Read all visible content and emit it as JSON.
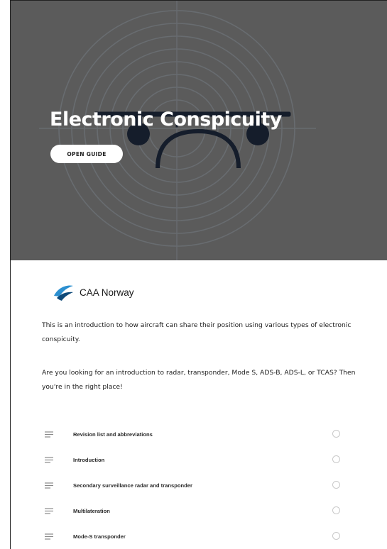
{
  "hero": {
    "title": "Electronic Conspicuity",
    "button_label": "OPEN GUIDE",
    "background_color": "#5b5b5b",
    "icon": "drone-radar-illustration"
  },
  "brand": {
    "name": "CAA Norway",
    "logo_icon": "caa-norway-logo",
    "logo_colors": [
      "#2b8fd0",
      "#0f4a7a"
    ]
  },
  "description": {
    "paragraph_1": "This is an introduction to how aircraft can share their position using various types of electronic conspicuity.",
    "paragraph_2": "Are you looking for an introduction to radar, transponder, Mode S, ADS-B, ADS-L, or TCAS? Then you're in the right place!"
  },
  "toc": {
    "item_icon": "lines-icon",
    "status_icon": "empty-circle-icon",
    "items": [
      {
        "label": "Revision list and abbreviations"
      },
      {
        "label": "Introduction"
      },
      {
        "label": "Secondary surveillance radar and transponder"
      },
      {
        "label": "Multilateration"
      },
      {
        "label": "Mode-S transponder"
      }
    ]
  }
}
